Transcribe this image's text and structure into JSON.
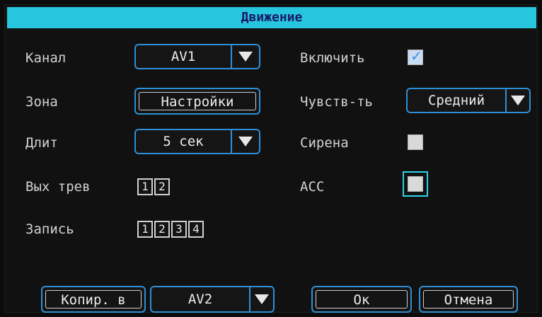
{
  "title": "Движение",
  "left": {
    "channel_label": "Канал",
    "channel_value": "AV1",
    "zone_label": "Зона",
    "zone_button": "Настройки",
    "duration_label": "Длит",
    "duration_value": "5 сек",
    "alarm_out_label": "Вых трев",
    "alarm_out_options": [
      "1",
      "2"
    ],
    "record_label": "Запись",
    "record_options": [
      "1",
      "2",
      "3",
      "4"
    ]
  },
  "right": {
    "enable_label": "Включить",
    "enable_checked": true,
    "sensitivity_label": "Чувств-ть",
    "sensitivity_value": "Средний",
    "siren_label": "Сирена",
    "siren_checked": false,
    "acc_label": "ACC",
    "acc_checked": false
  },
  "footer": {
    "copy_to_label": "Копир. в",
    "copy_target": "AV2",
    "ok_label": "Ок",
    "cancel_label": "Отмена"
  },
  "colors": {
    "title_bar": "#26c6df",
    "title_text": "#1a1a6a",
    "control_border": "#2f8fd6",
    "focus_border": "#30d0e8",
    "background": "#111111"
  }
}
